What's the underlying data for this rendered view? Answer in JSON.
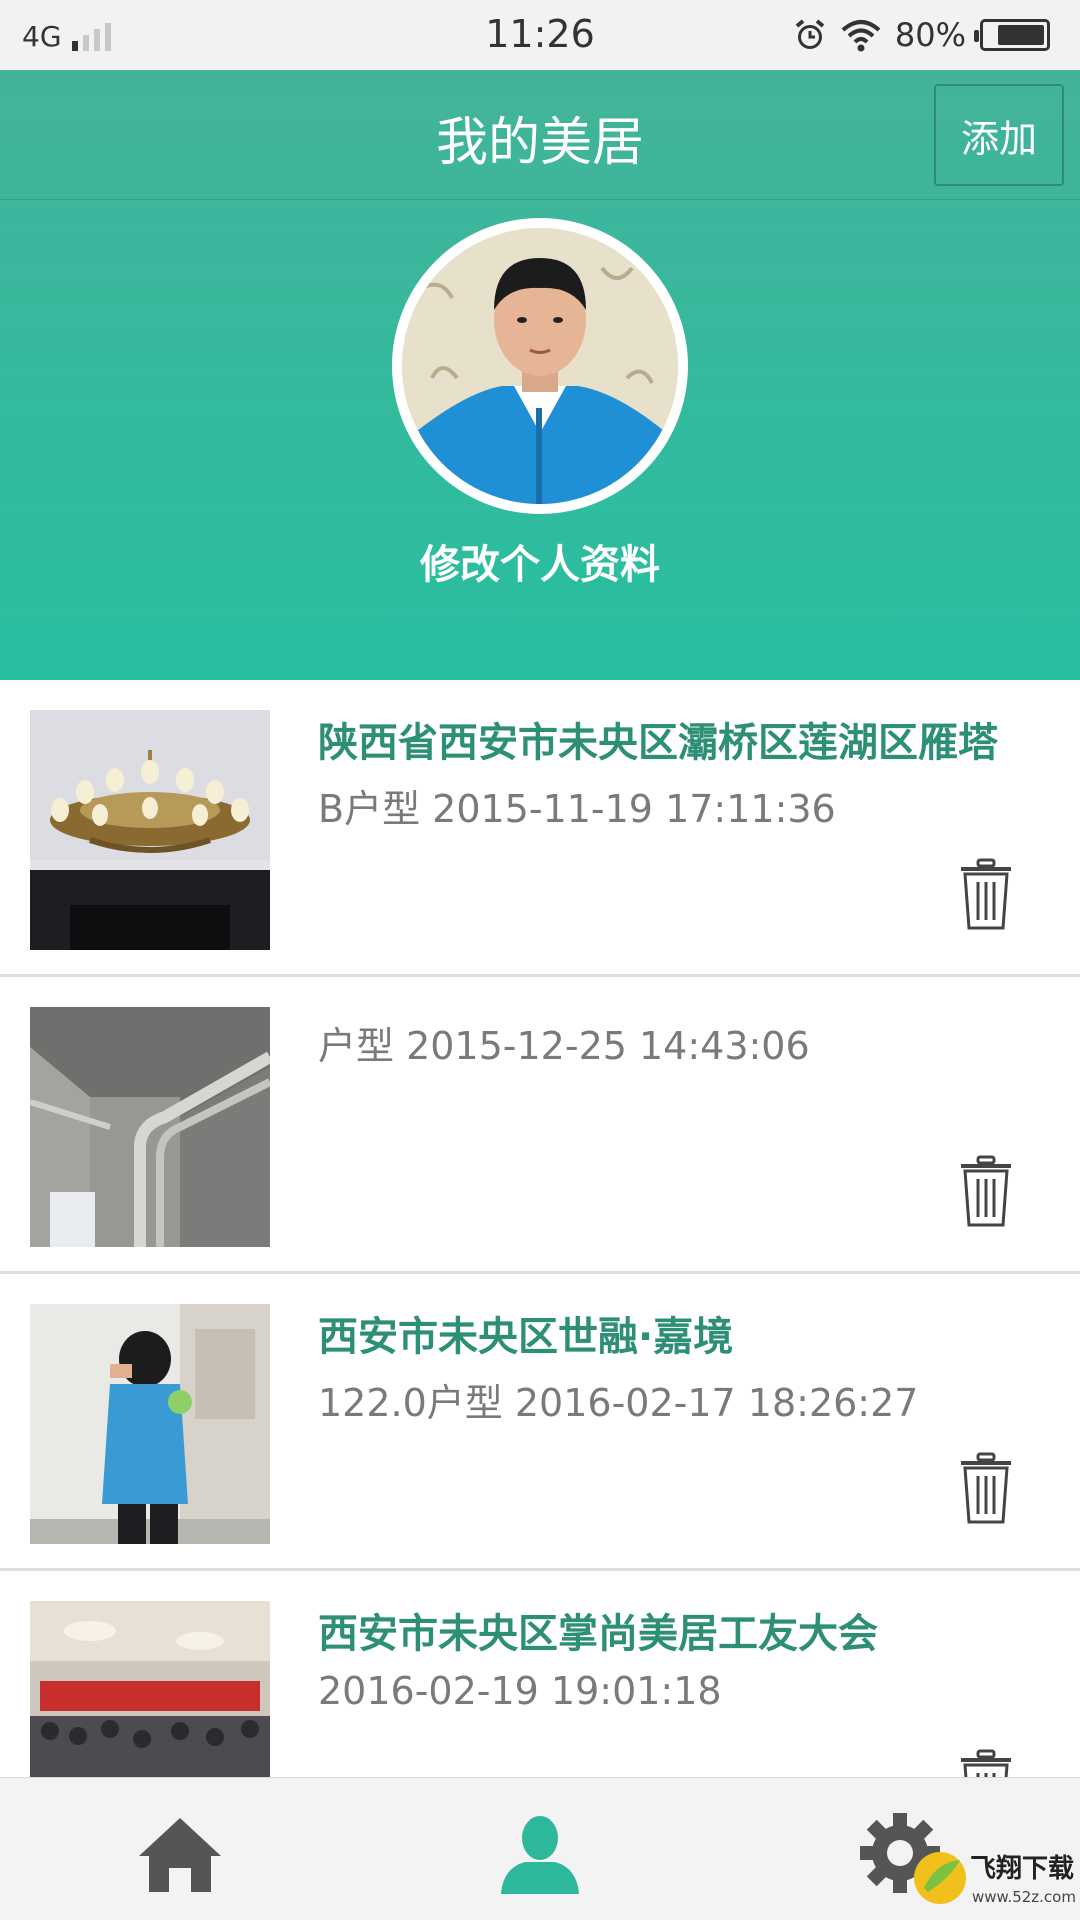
{
  "status_bar": {
    "network": "4G",
    "time": "11:26",
    "battery": "80%",
    "battery_level": 0.8
  },
  "header": {
    "title": "我的美居",
    "add_label": "添加",
    "edit_profile_label": "修改个人资料"
  },
  "list": [
    {
      "title": "陕西省西安市未央区灞桥区莲湖区雁塔",
      "meta": "B户型 2015-11-19 17:11:36",
      "thumb": "chandelier-photo"
    },
    {
      "title": "",
      "meta": "户型 2015-12-25 14:43:06",
      "thumb": "unfinished-room-photo"
    },
    {
      "title": "西安市未央区世融·嘉境",
      "meta": "122.0户型 2016-02-17 18:26:27",
      "thumb": "worker-photo"
    },
    {
      "title": "西安市未央区掌尚美居工友大会",
      "meta": "2016-02-19 19:01:18",
      "thumb": "conference-photo"
    }
  ],
  "bottom_nav": {
    "active": "profile",
    "icons": [
      "home-icon",
      "user-icon",
      "gear-icon"
    ]
  },
  "colors": {
    "accent": "#2db89c",
    "title_green": "#2c8f76",
    "meta_gray": "#7a7a7a"
  },
  "watermark": {
    "brand": "飞翔下载",
    "url": "www.52z.com"
  }
}
